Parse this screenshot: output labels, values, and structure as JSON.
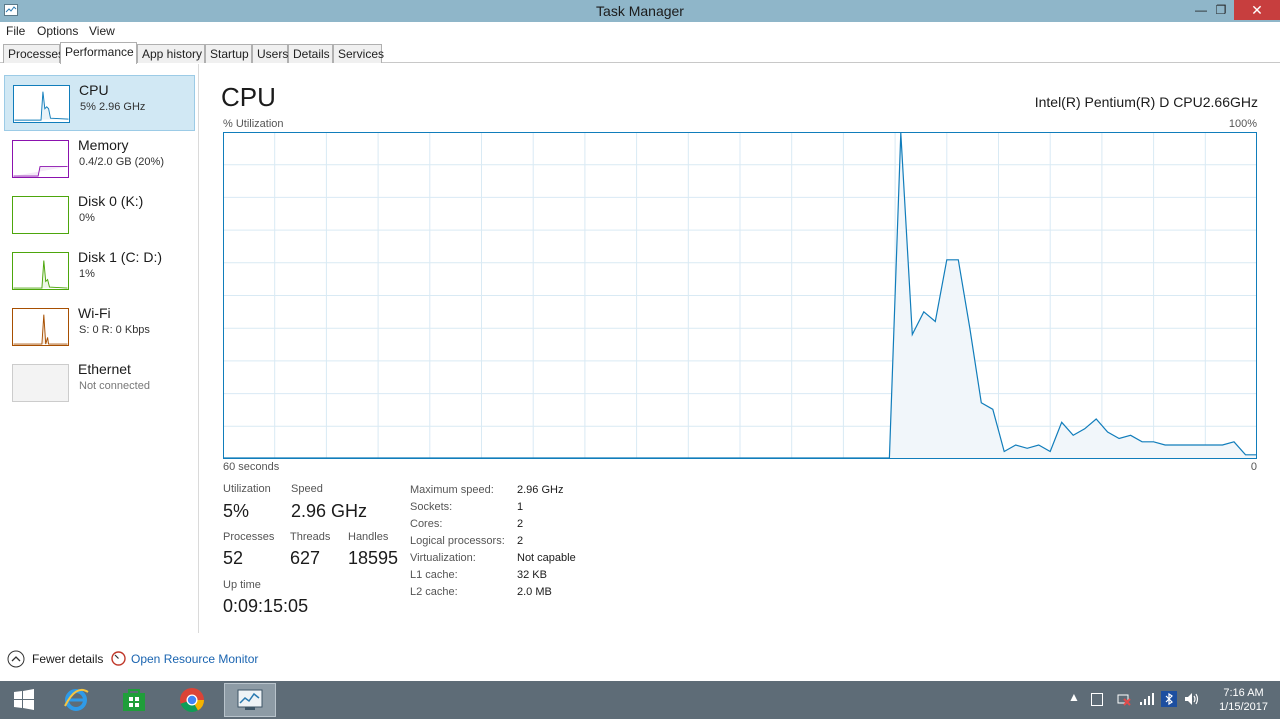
{
  "window": {
    "title": "Task Manager"
  },
  "menu": [
    "File",
    "Options",
    "View"
  ],
  "tabs": [
    "Processes",
    "Performance",
    "App history",
    "Startup",
    "Users",
    "Details",
    "Services"
  ],
  "sidebar": {
    "items": [
      {
        "name": "CPU",
        "sub": "5% 2.96 GHz",
        "color": "#117dbb"
      },
      {
        "name": "Memory",
        "sub": "0.4/2.0 GB (20%)",
        "color": "#8b12ae"
      },
      {
        "name": "Disk 0 (K:)",
        "sub": "0%",
        "color": "#4da60c"
      },
      {
        "name": "Disk 1 (C: D:)",
        "sub": "1%",
        "color": "#4da60c"
      },
      {
        "name": "Wi-Fi",
        "sub": "S: 0 R: 0 Kbps",
        "color": "#a74f01"
      },
      {
        "name": "Ethernet",
        "sub": "Not connected",
        "color": "#bbbbbb"
      }
    ]
  },
  "main": {
    "title": "CPU",
    "model": "Intel(R) Pentium(R) D CPU2.66GHz",
    "y_label": "% Utilization",
    "y_max": "100%",
    "x_left": "60 seconds",
    "x_right": "0",
    "graph_color": "#117dbb",
    "graph_fill": "#f1f6fa",
    "graph_grid": "#d9eaf4",
    "cpu_history": [
      0,
      0,
      0,
      0,
      0,
      0,
      0,
      0,
      0,
      0,
      0,
      0,
      0,
      0,
      0,
      0,
      0,
      0,
      0,
      0,
      0,
      0,
      0,
      0,
      0,
      0,
      0,
      0,
      0,
      0,
      0,
      0,
      0,
      0,
      0,
      0,
      0,
      0,
      0,
      0,
      0,
      0,
      0,
      0,
      0,
      0,
      0,
      0,
      0,
      0,
      0,
      0,
      0,
      0,
      0,
      0,
      0,
      0,
      0,
      100,
      38,
      45,
      42,
      61,
      61,
      40,
      17,
      15,
      2,
      4,
      3,
      4,
      2,
      11,
      7,
      9,
      12,
      8,
      6,
      7,
      5,
      5,
      4,
      4,
      4,
      4,
      4,
      4,
      5,
      1,
      1
    ]
  },
  "stats": {
    "utilization_label": "Utilization",
    "utilization": "5%",
    "speed_label": "Speed",
    "speed": "2.96 GHz",
    "processes_label": "Processes",
    "processes": "52",
    "threads_label": "Threads",
    "threads": "627",
    "handles_label": "Handles",
    "handles": "18595",
    "uptime_label": "Up time",
    "uptime": "0:09:15:05"
  },
  "details": [
    {
      "label": "Maximum speed:",
      "value": "2.96 GHz"
    },
    {
      "label": "Sockets:",
      "value": "1"
    },
    {
      "label": "Cores:",
      "value": "2"
    },
    {
      "label": "Logical processors:",
      "value": "2"
    },
    {
      "label": "Virtualization:",
      "value": "Not capable"
    },
    {
      "label": "L1 cache:",
      "value": "32 KB"
    },
    {
      "label": "L2 cache:",
      "value": "2.0 MB"
    }
  ],
  "footer": {
    "fewer_details": "Fewer details",
    "resource_monitor": "Open Resource Monitor"
  },
  "taskbar": {
    "time": "7:16 AM",
    "date": "1/15/2017"
  }
}
